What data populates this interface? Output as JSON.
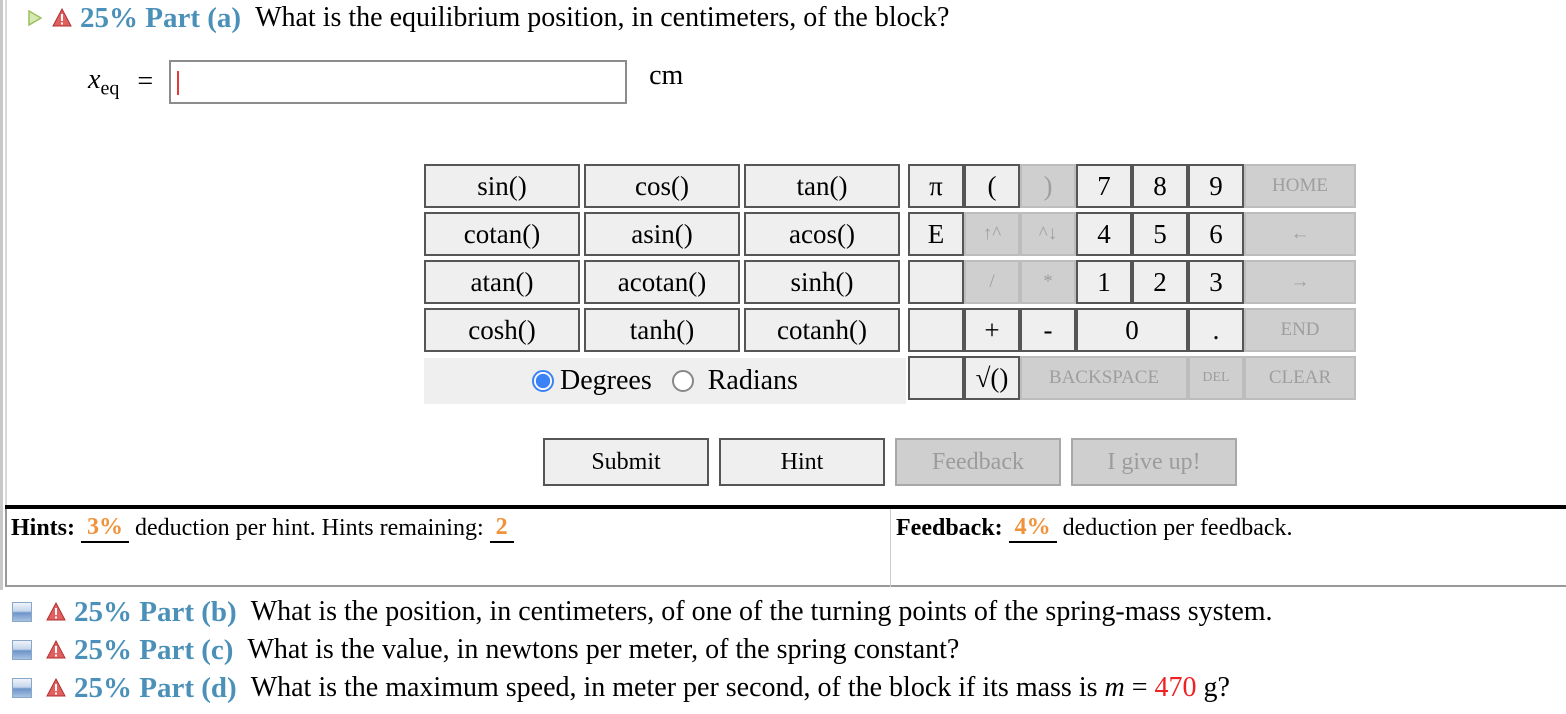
{
  "part_a": {
    "percent": "25% Part (a)",
    "question": "What is the equilibrium position, in centimeters, of the block?",
    "variable": "x",
    "variable_sub": "eq",
    "equals": "=",
    "input_value": "",
    "unit": "cm"
  },
  "calculator": {
    "functions": [
      "sin()",
      "cos()",
      "tan()",
      "cotan()",
      "asin()",
      "acos()",
      "atan()",
      "acotan()",
      "sinh()",
      "cosh()",
      "tanh()",
      "cotanh()"
    ],
    "angle_mode": {
      "options": [
        "Degrees",
        "Radians"
      ],
      "selected": "Degrees"
    },
    "keys": {
      "pi": "π",
      "open_paren": "(",
      "close_paren": ")",
      "e": "E",
      "up_power": "↑^",
      "power_down": "^↓",
      "divide": "/",
      "multiply": "*",
      "plus": "+",
      "minus": "-",
      "sqrt": "√()",
      "dot": ".",
      "digits": [
        "7",
        "8",
        "9",
        "4",
        "5",
        "6",
        "1",
        "2",
        "3",
        "0"
      ],
      "home": "HOME",
      "left": "←",
      "right": "→",
      "end": "END",
      "backspace": "BACKSPACE",
      "del": "DEL",
      "clear": "CLEAR"
    }
  },
  "actions": {
    "submit": "Submit",
    "hint": "Hint",
    "feedback": "Feedback",
    "give_up": "I give up!"
  },
  "hints": {
    "label": "Hints:",
    "deduction": "3%",
    "text": "deduction per hint. Hints remaining:",
    "remaining": "2"
  },
  "feedback": {
    "label": "Feedback:",
    "deduction": "4%",
    "text": "deduction per feedback."
  },
  "other_parts": [
    {
      "percent": "25% Part (b)",
      "question": "What is the position, in centimeters, of one of the turning points of the spring-mass system."
    },
    {
      "percent": "25% Part (c)",
      "question": "What is the value, in newtons per meter, of the spring constant?"
    },
    {
      "percent": "25% Part (d)",
      "question_prefix": "What is the maximum speed, in meter per second, of the block if its mass is",
      "var": "m",
      "eq": "=",
      "value": "470",
      "unit": "g?"
    }
  ],
  "colors": {
    "part_blue": "#4a90b8",
    "orange": "#f0923a",
    "red": "#e22222"
  }
}
